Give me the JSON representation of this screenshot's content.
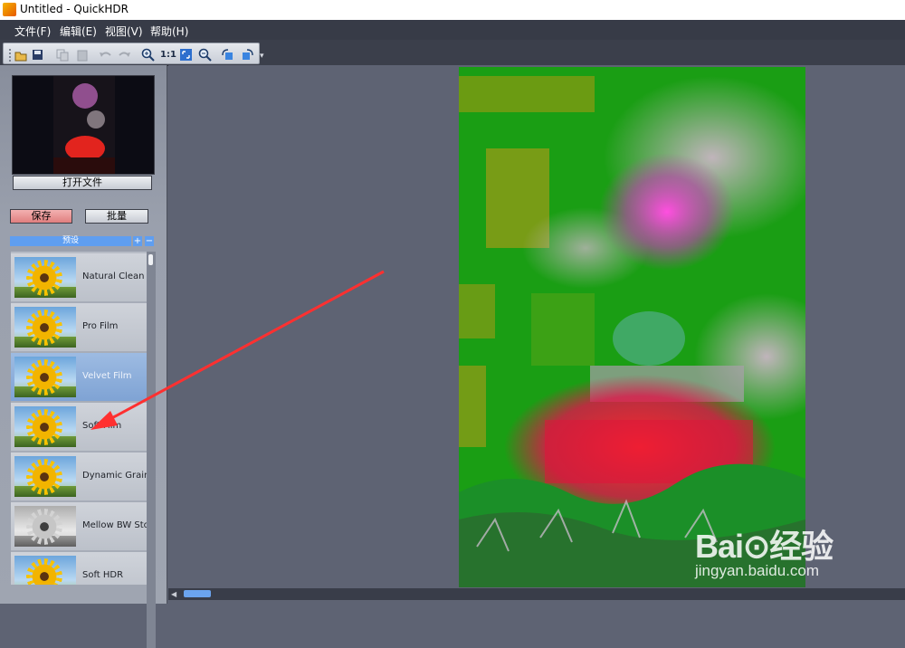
{
  "window": {
    "title": "Untitled - QuickHDR"
  },
  "menu": [
    {
      "label": "文件(F)"
    },
    {
      "label": "编辑(E)"
    },
    {
      "label": "视图(V)"
    },
    {
      "label": "帮助(H)"
    }
  ],
  "toolbar": {
    "actual_size_label": "1:1",
    "icons": [
      "open-icon",
      "save-icon",
      "copy-icon",
      "paste-icon",
      "undo-icon",
      "redo-icon",
      "zoom-in-icon",
      "actual-size-icon",
      "fit-window-icon",
      "zoom-out-icon",
      "rotate-left-icon",
      "rotate-right-icon"
    ]
  },
  "left_panel": {
    "open_file_label": "打开文件",
    "save_label": "保存",
    "batch_label": "批量",
    "presets_header": "预设",
    "presets_plus": "+",
    "presets_minus": "−",
    "presets": [
      {
        "label": "Natural Clean"
      },
      {
        "label": "Pro Film"
      },
      {
        "label": "Velvet Film"
      },
      {
        "label": "Soft Film"
      },
      {
        "label": "Dynamic Grain"
      },
      {
        "label": "Mellow BW Stoc"
      },
      {
        "label": "Soft HDR"
      }
    ],
    "selected_preset": "Velvet Film"
  },
  "watermark": {
    "brand": "Bai⊙经验",
    "url": "jingyan.baidu.com"
  },
  "colors": {
    "menubar": "#373b47",
    "canvas": "#5e6373",
    "accent": "#5f9ef0",
    "save": "#e07f7f",
    "arrow": "#ff3030"
  }
}
